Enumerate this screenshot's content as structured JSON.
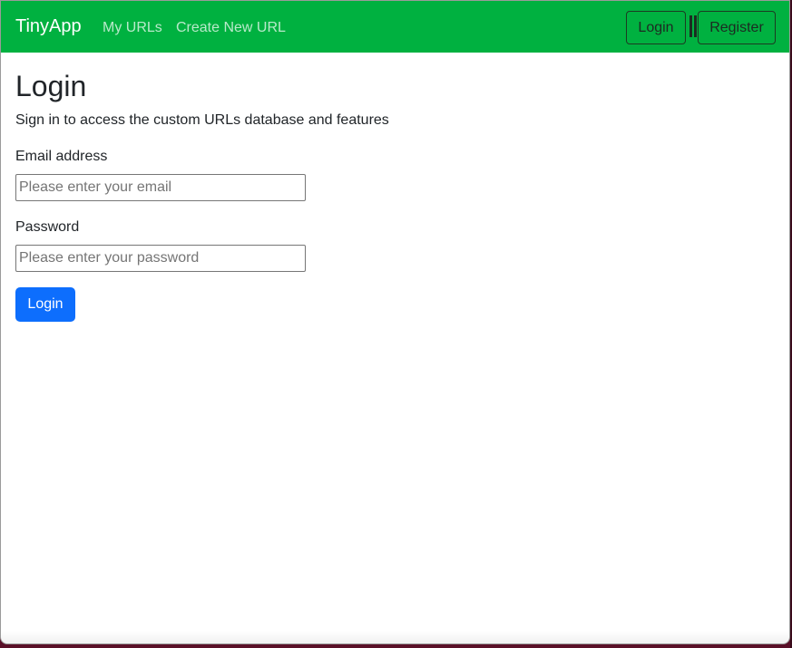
{
  "navbar": {
    "brand": "TinyApp",
    "links": [
      {
        "label": "My URLs"
      },
      {
        "label": "Create New URL"
      }
    ],
    "login_button": "Login",
    "register_button": "Register"
  },
  "page": {
    "title": "Login",
    "subtitle": "Sign in to access the custom URLs database and features"
  },
  "form": {
    "email_label": "Email address",
    "email_placeholder": "Please enter your email",
    "email_value": "",
    "password_label": "Password",
    "password_placeholder": "Please enter your password",
    "password_value": "",
    "submit_label": "Login"
  },
  "colors": {
    "navbar_bg": "#00b140",
    "primary_button": "#0d6efd",
    "text": "#212529"
  }
}
